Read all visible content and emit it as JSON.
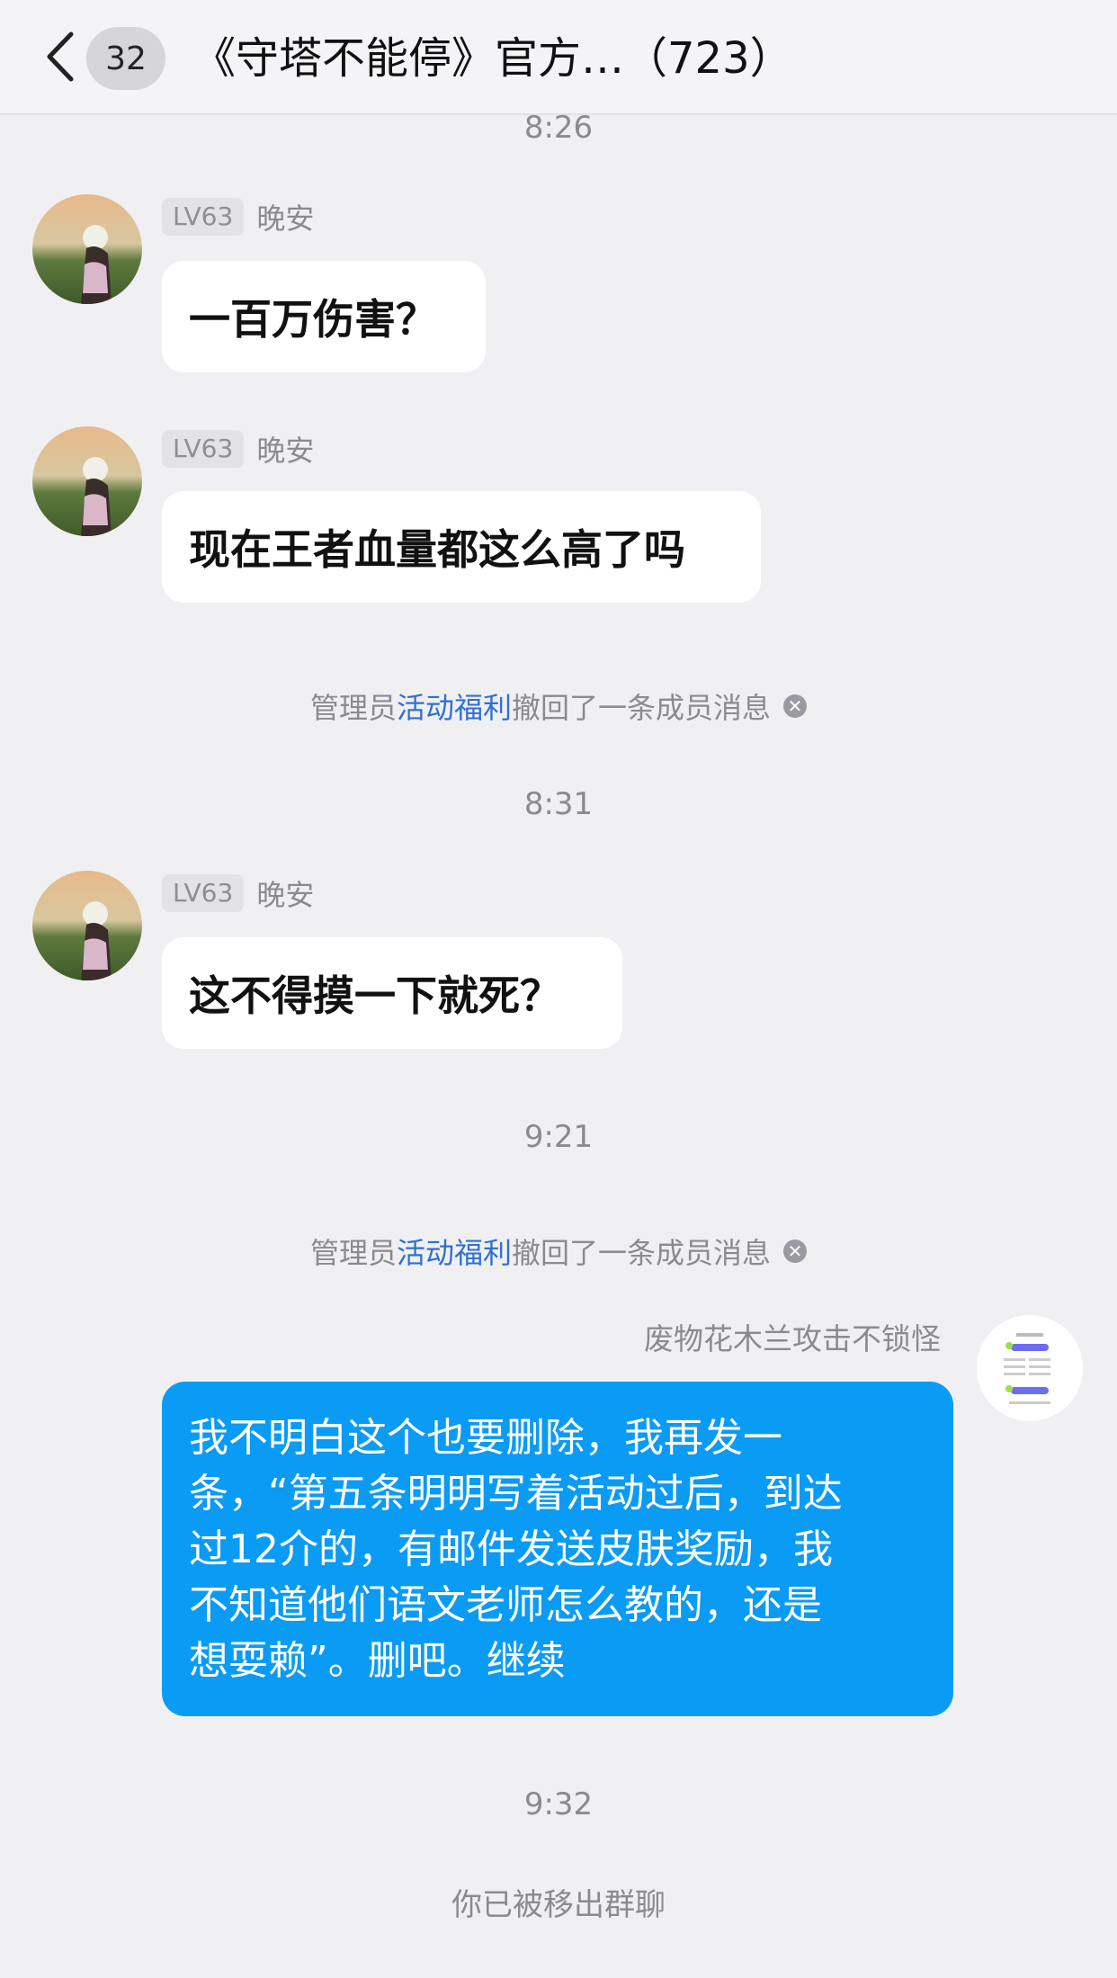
{
  "header": {
    "back_icon": "chevron-left-icon",
    "unread_count": "32",
    "title": "《守塔不能停》官方…（723）"
  },
  "timestamps": {
    "t1": "8:26",
    "t2": "8:31",
    "t3": "9:21",
    "t4": "9:32"
  },
  "messages": [
    {
      "level": "LV63",
      "nickname": "晚安",
      "text": "一百万伤害？"
    },
    {
      "level": "LV63",
      "nickname": "晚安",
      "text": "现在王者血量都这么高了吗"
    },
    {
      "level": "LV63",
      "nickname": "晚安",
      "text": "这不得摸一下就死？"
    }
  ],
  "system_notices": [
    {
      "prefix": "管理员",
      "link": "活动福利",
      "suffix": "撤回了一条成员消息"
    },
    {
      "prefix": "管理员",
      "link": "活动福利",
      "suffix": "撤回了一条成员消息"
    }
  ],
  "self_message": {
    "nickname": "废物花木兰攻击不锁怪",
    "lines": [
      "我不明白这个也要删除，我再发一",
      "条，“第五条明明写着活动过后，到达",
      "过12介的，有邮件发送皮肤奖励，我",
      "不知道他们语文老师怎么教的，还是",
      "想耍赖”。删吧。继续"
    ]
  },
  "final_notice": "你已被移出群聊",
  "colors": {
    "background": "#f0f0f3",
    "self_bubble": "#0a9bf5",
    "link": "#2f6fd6",
    "meta_text": "#8a8a8f"
  }
}
